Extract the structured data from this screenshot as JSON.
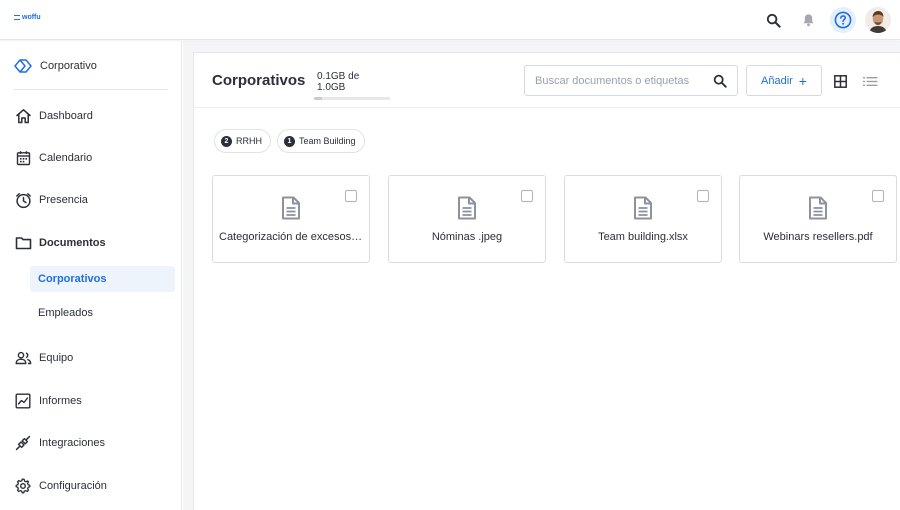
{
  "app": {
    "logo_text": "woffu"
  },
  "topbar": {
    "icons": [
      "search-icon",
      "bell-icon",
      "help-icon",
      "avatar"
    ]
  },
  "sidebar": {
    "company": "Corporativo",
    "items": [
      {
        "id": "dashboard",
        "label": "Dashboard",
        "icon": "home-icon"
      },
      {
        "id": "calendario",
        "label": "Calendario",
        "icon": "calendar-icon"
      },
      {
        "id": "presencia",
        "label": "Presencia",
        "icon": "clock-icon"
      },
      {
        "id": "documentos",
        "label": "Documentos",
        "icon": "folder-icon",
        "active": true
      },
      {
        "id": "equipo",
        "label": "Equipo",
        "icon": "team-icon"
      },
      {
        "id": "informes",
        "label": "Informes",
        "icon": "chart-icon"
      },
      {
        "id": "integraciones",
        "label": "Integraciones",
        "icon": "plug-icon"
      },
      {
        "id": "configuracion",
        "label": "Configuración",
        "icon": "gear-icon"
      }
    ],
    "subitems": [
      {
        "label": "Corporativos",
        "active": true
      },
      {
        "label": "Empleados",
        "active": false
      }
    ]
  },
  "main": {
    "title": "Corporativos",
    "storage": {
      "text": "0.1GB de 1.0GB",
      "used_fraction": 0.1
    },
    "search_placeholder": "Buscar documentos o etiquetas",
    "add_label": "Añadir",
    "add_symbol": "+",
    "tags": [
      {
        "count": "2",
        "label": "RRHH"
      },
      {
        "count": "1",
        "label": "Team Building"
      }
    ],
    "documents": [
      {
        "name": "Categorización de excesos de ..."
      },
      {
        "name": "Nóminas .jpeg"
      },
      {
        "name": "Team building.xlsx"
      },
      {
        "name": "Webinars resellers.pdf"
      }
    ]
  },
  "colors": {
    "accent": "#1f6fe0",
    "text": "#2b2f3a",
    "muted": "#9aa0ab"
  }
}
